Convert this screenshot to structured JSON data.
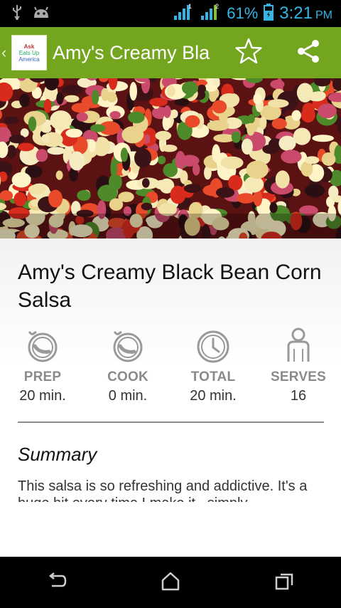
{
  "status_bar": {
    "battery_percent": "61%",
    "time": "3:21",
    "ampm": "PM",
    "signal_1_badge": "1",
    "signal_2_badge": "2",
    "icons": [
      "usb-icon",
      "android-icon",
      "signal-icon",
      "battery-icon"
    ]
  },
  "action_bar": {
    "title": "Amy's Creamy Black Bean Corn Salsa",
    "logo_lines": [
      "Ask",
      "Eats Up",
      "America"
    ],
    "icons": [
      "up-caret-icon",
      "star-icon",
      "share-icon"
    ],
    "colors": {
      "background": "#73a51f"
    }
  },
  "recipe": {
    "title": "Amy's Creamy Black Bean Corn Salsa",
    "stats": [
      {
        "label": "PREP",
        "value": "20 min.",
        "icon": "timer-icon"
      },
      {
        "label": "COOK",
        "value": "0 min.",
        "icon": "timer-icon"
      },
      {
        "label": "TOTAL",
        "value": "20 min.",
        "icon": "clock-icon"
      },
      {
        "label": "SERVES",
        "value": "16",
        "icon": "person-icon"
      }
    ],
    "summary_heading": "Summary",
    "summary_text": "This salsa is so refreshing and addictive. It's a huge hit every time I make it...simply"
  },
  "nav_bar": {
    "icons": [
      "back-icon",
      "home-icon",
      "recent-apps-icon"
    ]
  }
}
